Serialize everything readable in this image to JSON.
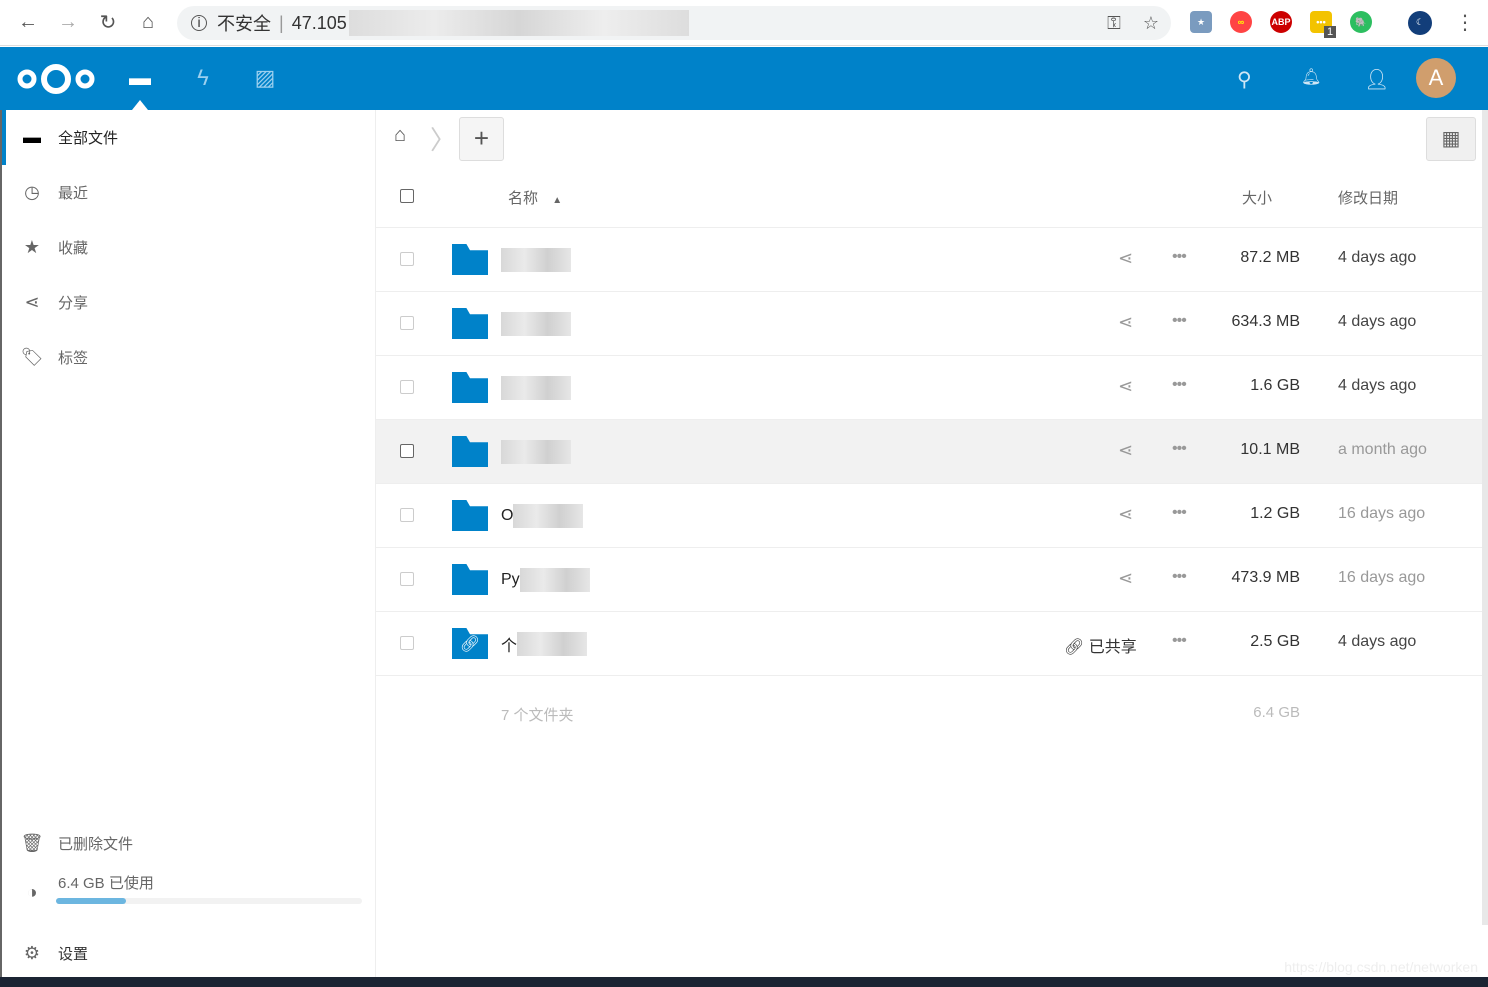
{
  "browser": {
    "security_label": "不安全",
    "url_prefix": "47.105",
    "extension_badge": "1"
  },
  "header": {
    "avatar_letter": "A",
    "accent": "#0082c9",
    "avatar_color": "#d09e6d"
  },
  "sidebar": {
    "items": [
      {
        "label": "全部文件",
        "icon": "folder-icon"
      },
      {
        "label": "最近",
        "icon": "clock-icon"
      },
      {
        "label": "收藏",
        "icon": "star-icon"
      },
      {
        "label": "分享",
        "icon": "share-icon"
      },
      {
        "label": "标签",
        "icon": "tag-icon"
      }
    ],
    "trash": "已删除文件",
    "quota_label": "6.4 GB 已使用",
    "quota_percent": 23,
    "settings": "设置"
  },
  "table": {
    "col_name": "名称",
    "col_size": "大小",
    "col_modified": "修改日期",
    "rows": [
      {
        "name": "",
        "size": "87.2 MB",
        "modified": "4 days ago",
        "shared": false
      },
      {
        "name": "",
        "size": "634.3 MB",
        "modified": "4 days ago",
        "shared": false
      },
      {
        "name": "",
        "size": "1.6 GB",
        "modified": "4 days ago",
        "shared": false
      },
      {
        "name": "",
        "size": "10.1 MB",
        "modified": "a month ago",
        "shared": false
      },
      {
        "name": "O",
        "size": "1.2 GB",
        "modified": "16 days ago",
        "shared": false
      },
      {
        "name": "Py",
        "size": "473.9 MB",
        "modified": "16 days ago",
        "shared": false
      },
      {
        "name": "个",
        "size": "2.5 GB",
        "modified": "4 days ago",
        "shared": true,
        "shared_label": "已共享"
      }
    ],
    "summary_count": "7 个文件夹",
    "summary_size": "6.4 GB"
  },
  "watermark": "https://blog.csdn.net/networken"
}
